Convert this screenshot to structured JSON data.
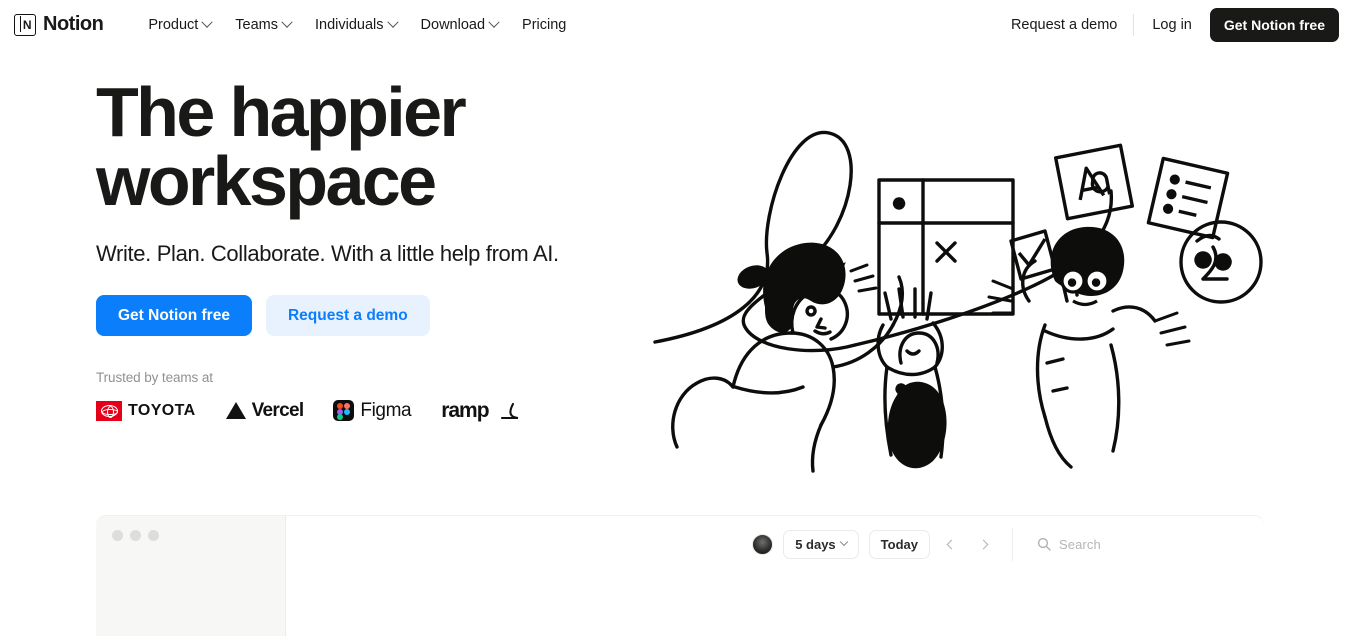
{
  "header": {
    "logo_text": "Notion",
    "logo_letter": "N",
    "nav": [
      {
        "label": "Product",
        "has_chevron": true
      },
      {
        "label": "Teams",
        "has_chevron": true
      },
      {
        "label": "Individuals",
        "has_chevron": true
      },
      {
        "label": "Download",
        "has_chevron": true
      },
      {
        "label": "Pricing",
        "has_chevron": false
      }
    ],
    "request_demo": "Request a demo",
    "login": "Log in",
    "cta": "Get Notion free"
  },
  "hero": {
    "title_line1": "The happier",
    "title_line2": "workspace",
    "subtitle": "Write. Plan. Collaborate. With a little help from AI.",
    "primary_cta": "Get Notion free",
    "secondary_cta": "Request a demo",
    "trusted_label": "Trusted by teams at",
    "logos": [
      {
        "name": "Toyota",
        "text": "TOYOTA",
        "color": "#e50019"
      },
      {
        "name": "Vercel",
        "text": "Vercel",
        "color": "#111111"
      },
      {
        "name": "Figma",
        "text": "Figma",
        "color": "#0d0d0d"
      },
      {
        "name": "ramp",
        "text": "ramp",
        "color": "#111111"
      }
    ]
  },
  "app": {
    "range_selector": "5 days",
    "today_button": "Today",
    "search_placeholder": "Search"
  },
  "colors": {
    "accent_blue": "#0b7ffb",
    "accent_blue_soft": "#e8f2fe",
    "dark": "#191918",
    "page_bg": "#ffffff",
    "sidebar_bg": "#f7f7f5"
  }
}
